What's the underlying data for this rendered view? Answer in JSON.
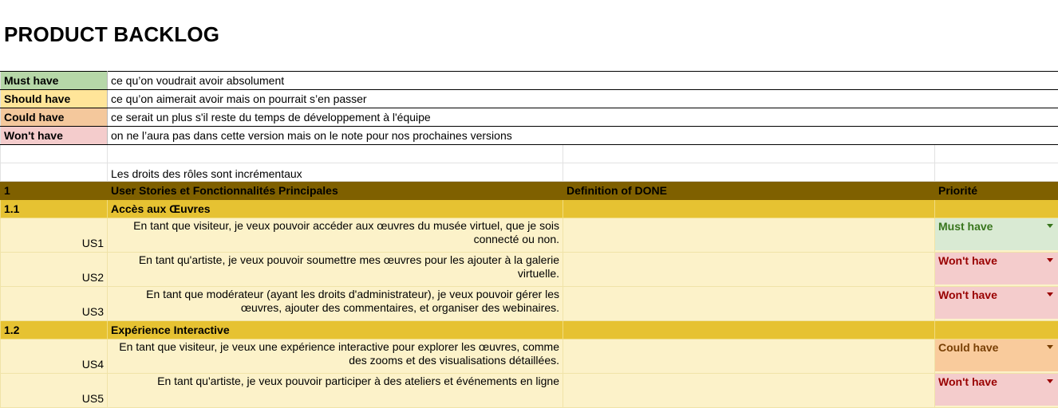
{
  "title": "PRODUCT BACKLOG",
  "legend": [
    {
      "label": "Must have",
      "desc": "ce qu’on voudrait avoir absolument"
    },
    {
      "label": "Should have",
      "desc": "ce qu’on aimerait avoir mais on pourrait s’en passer"
    },
    {
      "label": "Could have",
      "desc": "ce serait un plus s'il reste du temps de développement à l'équipe"
    },
    {
      "label": "Won't have",
      "desc": "on ne l’aura pas dans cette version mais on le note pour nos prochaines versions"
    }
  ],
  "note": "Les droits des rôles sont incrémentaux",
  "header": {
    "num": "1",
    "stories": "User Stories et Fonctionnalités Principales",
    "done": "Definition of DONE",
    "priority": "Priorité"
  },
  "sections": [
    {
      "num": "1.1",
      "title": "Accès aux Œuvres",
      "stories": [
        {
          "id": "US1",
          "text": "En tant que visiteur, je veux pouvoir accéder aux œuvres du musée virtuel, que je sois connecté ou non.",
          "priority": "Must have"
        },
        {
          "id": "US2",
          "text": "En tant qu'artiste, je veux pouvoir soumettre mes œuvres pour les ajouter à la galerie virtuelle.",
          "priority": "Won't have"
        },
        {
          "id": "US3",
          "text": "En tant que modérateur (ayant les droits d'administrateur), je veux pouvoir gérer les œuvres, ajouter des commentaires, et organiser des webinaires.",
          "priority": "Won't have"
        }
      ]
    },
    {
      "num": "1.2",
      "title": "Expérience Interactive",
      "stories": [
        {
          "id": "US4",
          "text": "En tant que visiteur, je veux une expérience interactive pour explorer les œuvres, comme des zooms et des visualisations détaillées.",
          "priority": "Could have"
        },
        {
          "id": "US5",
          "text": "En tant qu'artiste, je veux pouvoir participer à des ateliers et événements en ligne",
          "priority": "Won't have"
        }
      ]
    }
  ]
}
